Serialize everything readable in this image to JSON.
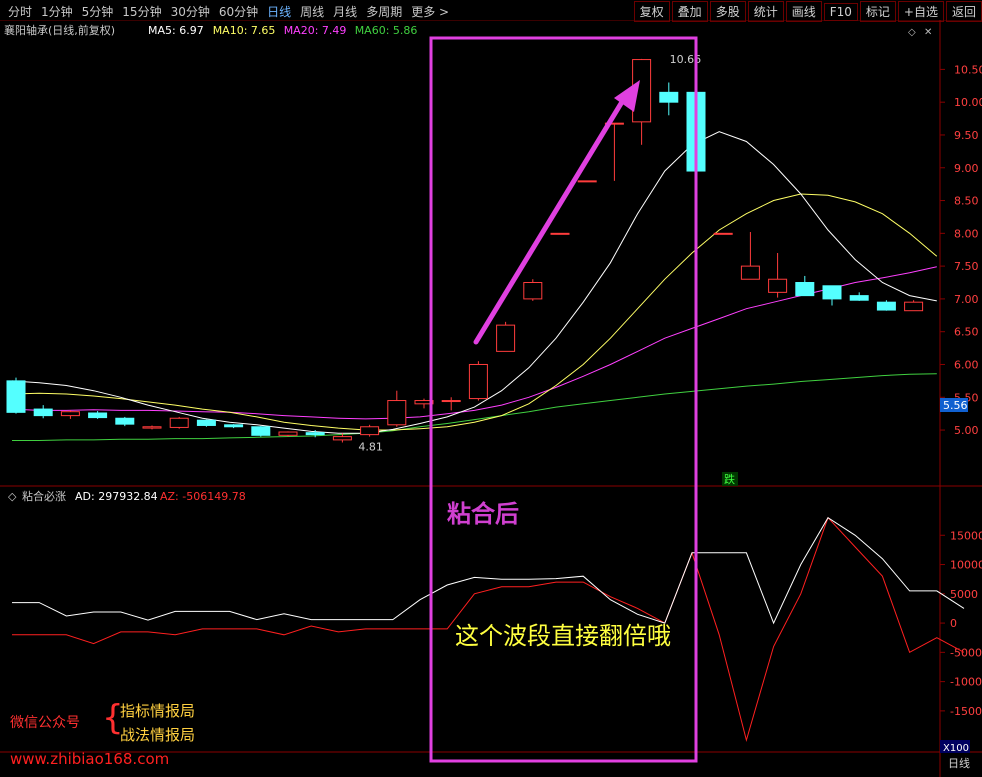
{
  "toolbar": {
    "periods": [
      "分时",
      "1分钟",
      "5分钟",
      "15分钟",
      "30分钟",
      "60分钟",
      "日线",
      "周线",
      "月线",
      "多周期",
      "更多 >"
    ],
    "active_period": "日线",
    "actions": [
      "复权",
      "叠加",
      "多股",
      "统计",
      "画线",
      "F10",
      "标记",
      "+自选",
      "返回"
    ]
  },
  "main": {
    "title": "襄阳轴承(日线,前复权)",
    "ma_labels": [
      {
        "text": "MA5: 6.97",
        "color": "#ffffff"
      },
      {
        "text": "MA10: 7.65",
        "color": "#ffff66"
      },
      {
        "text": "MA20: 7.49",
        "color": "#ff40ff"
      },
      {
        "text": "MA60: 5.86",
        "color": "#40d040"
      }
    ],
    "price_ticks": [
      "10.50",
      "10.00",
      "9.50",
      "9.00",
      "8.50",
      "8.00",
      "7.50",
      "7.00",
      "6.50",
      "6.00",
      "5.50",
      "5.00"
    ],
    "current_price_tag": "5.56",
    "high_label": "10.66",
    "low_label": "4.81",
    "die_label": "跌"
  },
  "indicator": {
    "title": "粘合必涨",
    "ad_label": "AD: 297932.84",
    "az_label": "AZ: -506149.78",
    "ticks": [
      "15000",
      "10000",
      "5000",
      "0",
      "-5000",
      "-10000",
      "-15000"
    ],
    "zoom": "X100",
    "bottom_tab": "日线"
  },
  "annotations": {
    "box_title": "粘合后",
    "box_caption": "这个波段直接翻倍哦"
  },
  "watermark": {
    "label": "微信公众号",
    "brace": "{",
    "line1": "指标情报局",
    "line2": "战法情报局",
    "url": "www.zhibiao168.com"
  },
  "colors": {
    "up": "#ff3c3c",
    "down": "#54ffff",
    "ma5": "#ffffff",
    "ma10": "#ffff66",
    "ma20": "#ff40ff",
    "ma60": "#40d040",
    "ad": "#ffffff",
    "az": "#ff2020",
    "magenta": "#e040e0",
    "axis": "#8a0000"
  },
  "chart_data": {
    "type": "candlestick",
    "x": [
      "1",
      "2",
      "3",
      "4",
      "5",
      "6",
      "7",
      "8",
      "9",
      "10",
      "11",
      "12",
      "13",
      "14",
      "15",
      "16",
      "17",
      "18",
      "19",
      "20",
      "21",
      "22",
      "23",
      "24",
      "25",
      "26",
      "27",
      "28",
      "29",
      "30",
      "31",
      "32",
      "33"
    ],
    "ohlc": [
      [
        5.75,
        5.8,
        5.25,
        5.27
      ],
      [
        5.32,
        5.38,
        5.18,
        5.22
      ],
      [
        5.22,
        5.3,
        5.17,
        5.28
      ],
      [
        5.26,
        5.29,
        5.17,
        5.19
      ],
      [
        5.18,
        5.2,
        5.06,
        5.09
      ],
      [
        5.03,
        5.07,
        5.01,
        5.05
      ],
      [
        5.04,
        5.2,
        5.02,
        5.18
      ],
      [
        5.15,
        5.16,
        5.05,
        5.07
      ],
      [
        5.08,
        5.09,
        5.03,
        5.05
      ],
      [
        5.05,
        5.06,
        4.9,
        4.92
      ],
      [
        4.92,
        4.98,
        4.9,
        4.97
      ],
      [
        4.96,
        5.0,
        4.89,
        4.93
      ],
      [
        4.85,
        4.95,
        4.81,
        4.9
      ],
      [
        4.93,
        5.08,
        4.9,
        5.05
      ],
      [
        5.08,
        5.6,
        5.05,
        5.45
      ],
      [
        5.4,
        5.48,
        5.33,
        5.45
      ],
      [
        5.45,
        5.5,
        5.3,
        5.45
      ],
      [
        5.48,
        6.05,
        5.45,
        6.0
      ],
      [
        6.2,
        6.65,
        6.2,
        6.6
      ],
      [
        7.0,
        7.3,
        6.97,
        7.25
      ],
      [
        8.0,
        8.0,
        8.0,
        8.0
      ],
      [
        8.8,
        8.8,
        8.8,
        8.8
      ],
      [
        9.68,
        9.68,
        8.8,
        9.68
      ],
      [
        9.7,
        10.66,
        9.35,
        10.65
      ],
      [
        10.15,
        10.3,
        9.8,
        10.0
      ],
      [
        10.15,
        10.25,
        8.95,
        8.95
      ],
      [
        8.0,
        8.0,
        8.0,
        8.0
      ],
      [
        7.3,
        8.02,
        7.3,
        7.5
      ],
      [
        7.1,
        7.7,
        7.02,
        7.3
      ],
      [
        7.25,
        7.35,
        7.05,
        7.05
      ],
      [
        7.2,
        7.2,
        6.9,
        7.0
      ],
      [
        7.05,
        7.1,
        6.97,
        6.98
      ],
      [
        6.95,
        6.98,
        6.82,
        6.83
      ],
      [
        6.82,
        6.98,
        6.82,
        6.95
      ]
    ],
    "ma5": [
      5.75,
      5.72,
      5.68,
      5.6,
      5.5,
      5.38,
      5.28,
      5.18,
      5.12,
      5.08,
      5.03,
      4.98,
      4.95,
      4.95,
      5.01,
      5.1,
      5.2,
      5.35,
      5.6,
      5.95,
      6.4,
      6.95,
      7.55,
      8.3,
      8.95,
      9.35,
      9.55,
      9.4,
      9.05,
      8.6,
      8.05,
      7.6,
      7.25,
      7.05,
      6.97
    ],
    "ma10": [
      5.55,
      5.56,
      5.55,
      5.52,
      5.48,
      5.43,
      5.38,
      5.32,
      5.27,
      5.2,
      5.12,
      5.07,
      5.03,
      5.0,
      5.0,
      5.02,
      5.05,
      5.12,
      5.22,
      5.4,
      5.68,
      6.0,
      6.4,
      6.85,
      7.3,
      7.7,
      8.05,
      8.3,
      8.5,
      8.6,
      8.58,
      8.48,
      8.3,
      8.0,
      7.65
    ],
    "ma20": [
      5.32,
      5.3,
      5.3,
      5.31,
      5.3,
      5.3,
      5.29,
      5.28,
      5.27,
      5.25,
      5.22,
      5.2,
      5.18,
      5.17,
      5.18,
      5.2,
      5.25,
      5.3,
      5.38,
      5.5,
      5.65,
      5.82,
      6.0,
      6.2,
      6.4,
      6.55,
      6.7,
      6.85,
      6.95,
      7.05,
      7.15,
      7.25,
      7.32,
      7.4,
      7.49
    ],
    "ma60": [
      4.84,
      4.84,
      4.85,
      4.85,
      4.86,
      4.86,
      4.87,
      4.87,
      4.88,
      4.89,
      4.9,
      4.91,
      4.93,
      4.95,
      4.99,
      5.05,
      5.1,
      5.16,
      5.22,
      5.28,
      5.35,
      5.4,
      5.45,
      5.5,
      5.55,
      5.59,
      5.63,
      5.67,
      5.7,
      5.74,
      5.77,
      5.8,
      5.83,
      5.85,
      5.86
    ],
    "ad": [
      3500,
      3500,
      1200,
      1900,
      1900,
      500,
      2000,
      2000,
      2000,
      600,
      1600,
      600,
      600,
      600,
      600,
      4000,
      6500,
      7800,
      7500,
      7500,
      7600,
      8000,
      4000,
      1500,
      0,
      12000,
      12000,
      12000,
      0,
      10000,
      18000,
      15000,
      11000,
      5500,
      5500,
      2500
    ],
    "az": [
      -2000,
      -2000,
      -2000,
      -3500,
      -1500,
      -1500,
      -2000,
      -1000,
      -1000,
      -1000,
      -2000,
      -500,
      -1500,
      -1000,
      -1000,
      -1000,
      -1000,
      5000,
      6200,
      6200,
      7000,
      7000,
      4500,
      2500,
      0,
      12000,
      -2000,
      -20000,
      -4000,
      5000,
      18000,
      13000,
      8000,
      -5000,
      -2500,
      -5000
    ],
    "ylim_price": [
      4.65,
      10.75
    ],
    "ylim_indicator": [
      -21000,
      20000
    ]
  }
}
